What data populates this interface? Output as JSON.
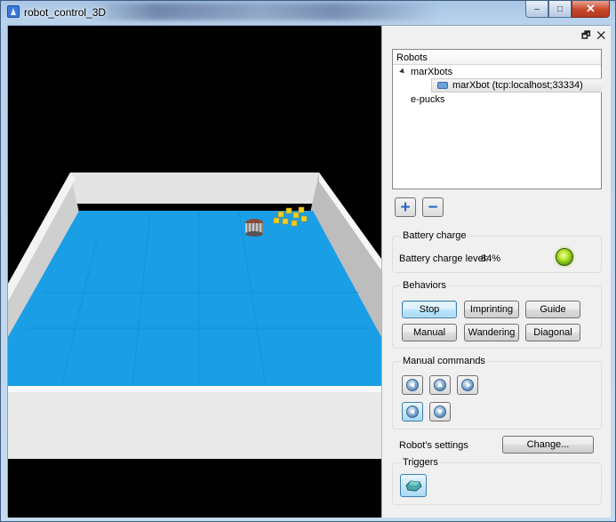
{
  "window": {
    "title": "robot_control_3D",
    "minimize": "–",
    "maximize": "□",
    "close": "✕"
  },
  "dock": {
    "float_icon": "float-icon",
    "close_icon": "close-icon",
    "controls": "🗗 ✕"
  },
  "robots": {
    "header": "Robots",
    "tree": [
      {
        "label": "marXbots",
        "expanded": true,
        "children": [
          {
            "label": "marXbot (tcp:localhost;33334)",
            "selected": true
          }
        ]
      },
      {
        "label": "e-pucks",
        "expanded": false,
        "children": []
      }
    ],
    "add_label": "+",
    "remove_label": "−"
  },
  "battery": {
    "group_title": "Battery charge",
    "level_label": "Battery charge level:",
    "level_value": "84%",
    "led_color": "#9ccf2a"
  },
  "behaviors": {
    "group_title": "Behaviors",
    "buttons": [
      "Stop",
      "Imprinting",
      "Guide",
      "Manual",
      "Wandering",
      "Diagonal"
    ]
  },
  "manual": {
    "group_title": "Manual commands",
    "icons": [
      "arrow-left-icon",
      "arrow-up-icon",
      "arrow-right-icon",
      "rotate-left-icon",
      "arrow-down-icon"
    ]
  },
  "settings": {
    "label": "Robot's settings",
    "change_button": "Change..."
  },
  "triggers": {
    "group_title": "Triggers",
    "icon": "trigger-object-icon"
  },
  "colors": {
    "arena_floor": "#1a9ee6",
    "arena_wall": "#dcdcdc",
    "viewport_bg": "#000000",
    "accent": "#3c7fb1"
  }
}
